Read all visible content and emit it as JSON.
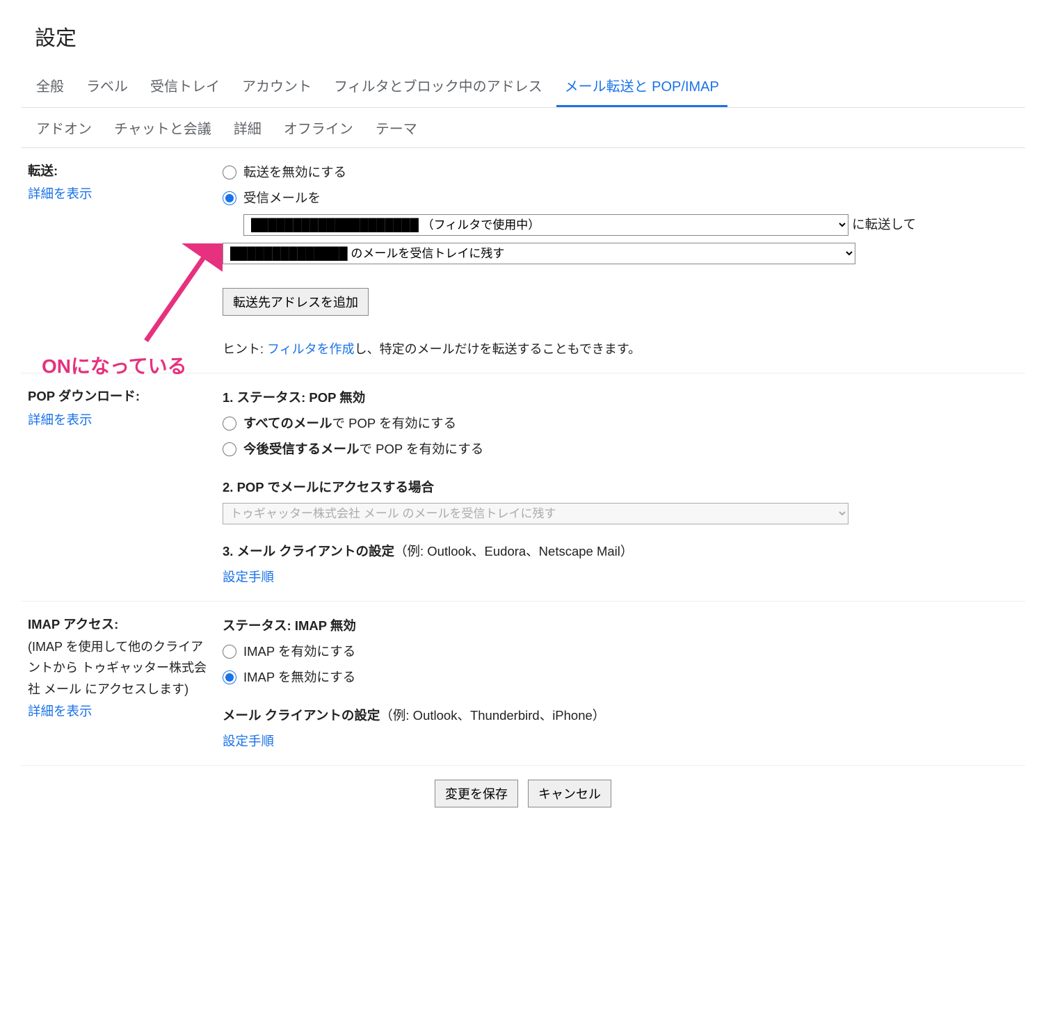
{
  "page_title": "設定",
  "tabs_row1": [
    {
      "label": "全般"
    },
    {
      "label": "ラベル"
    },
    {
      "label": "受信トレイ"
    },
    {
      "label": "アカウント"
    },
    {
      "label": "フィルタとブロック中のアドレス"
    },
    {
      "label": "メール転送と POP/IMAP",
      "active": true
    }
  ],
  "tabs_row2": [
    {
      "label": "アドオン"
    },
    {
      "label": "チャットと会議"
    },
    {
      "label": "詳細"
    },
    {
      "label": "オフライン"
    },
    {
      "label": "テーマ"
    }
  ],
  "forwarding": {
    "title": "転送:",
    "learn_more": "詳細を表示",
    "disable_label": "転送を無効にする",
    "enable_label": "受信メールを",
    "address_blurred": "xxxxxxxxxxxxxxxxxxxxxxxxxxxx",
    "address_suffix": "（フィルタで使用中）",
    "to_text": "に転送して",
    "keep_blurred": "xxxxxxxxxxxxxxxxxxx",
    "keep_suffix": "のメールを受信トレイに残す",
    "add_address_btn": "転送先アドレスを追加",
    "hint_prefix": "ヒント: ",
    "hint_link": "フィルタを作成",
    "hint_suffix": "し、特定のメールだけを転送することもできます。"
  },
  "pop": {
    "title": "POP ダウンロード:",
    "learn_more": "詳細を表示",
    "status_prefix": "1. ステータス: ",
    "status_value": "POP 無効",
    "opt1_bold": "すべてのメール",
    "opt1_rest": "で POP を有効にする",
    "opt2_bold": "今後受信するメール",
    "opt2_rest": "で POP を有効にする",
    "step2": "2. POP でメールにアクセスする場合",
    "step2_select": "トゥギャッター株式会社 メール のメールを受信トレイに残す",
    "step3_bold": "3. メール クライアントの設定",
    "step3_rest": "（例: Outlook、Eudora、Netscape Mail）",
    "step3_link": "設定手順"
  },
  "imap": {
    "title": "IMAP アクセス:",
    "desc": "(IMAP を使用して他のクライアントから トゥギャッター株式会社 メール にアクセスします)",
    "learn_more": "詳細を表示",
    "status_prefix": "ステータス: ",
    "status_value": "IMAP 無効",
    "enable": "IMAP を有効にする",
    "disable": "IMAP を無効にする",
    "client_bold": "メール クライアントの設定",
    "client_rest": "（例: Outlook、Thunderbird、iPhone）",
    "client_link": "設定手順"
  },
  "buttons": {
    "save": "変更を保存",
    "cancel": "キャンセル"
  },
  "annotation": {
    "text": "ONになっている"
  }
}
